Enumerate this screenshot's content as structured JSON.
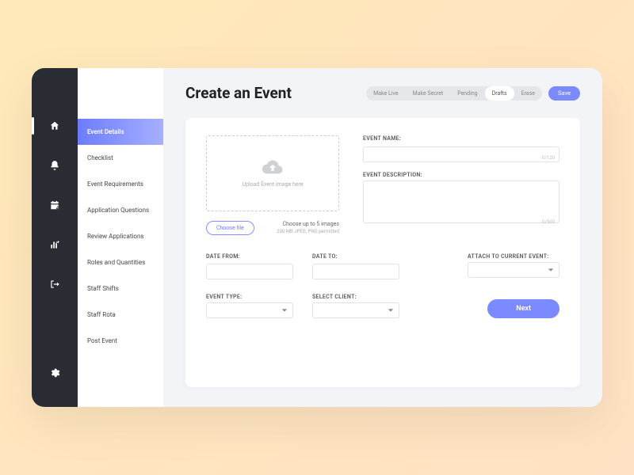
{
  "page": {
    "title": "Create an Event"
  },
  "tabs": {
    "make_live": "Make Live",
    "make_secret": "Make Secret",
    "pending": "Pending",
    "drafts": "Drafts",
    "erase": "Erase",
    "save": "Save"
  },
  "subnav": {
    "event_details": "Event Details",
    "checklist": "Checklist",
    "event_requirements": "Event Requirements",
    "application_questions": "Application Questions",
    "review_applications": "Review Applications",
    "roles_and_quantities": "Roles and Quantities",
    "staff_shifts": "Staff Shifts",
    "staff_rota": "Staff Rota",
    "post_event": "Post Event"
  },
  "upload": {
    "placeholder": "Upload Event image here",
    "choose": "Choose file",
    "hint": "Choose up to 5 images",
    "hint_sub": "200 MB JPEG, PNG permitted"
  },
  "fields": {
    "event_name_label": "EVENT NAME:",
    "event_name_counter": "0/120",
    "event_desc_label": "EVENT DESCRIPTION:",
    "event_desc_counter": "0/500",
    "date_from_label": "DATE FROM:",
    "date_to_label": "DATE TO:",
    "attach_label": "ATTACH TO CURRENT EVENT:",
    "event_type_label": "EVENT TYPE:",
    "select_client_label": "SELECT CLIENT:"
  },
  "buttons": {
    "next": "Next"
  }
}
